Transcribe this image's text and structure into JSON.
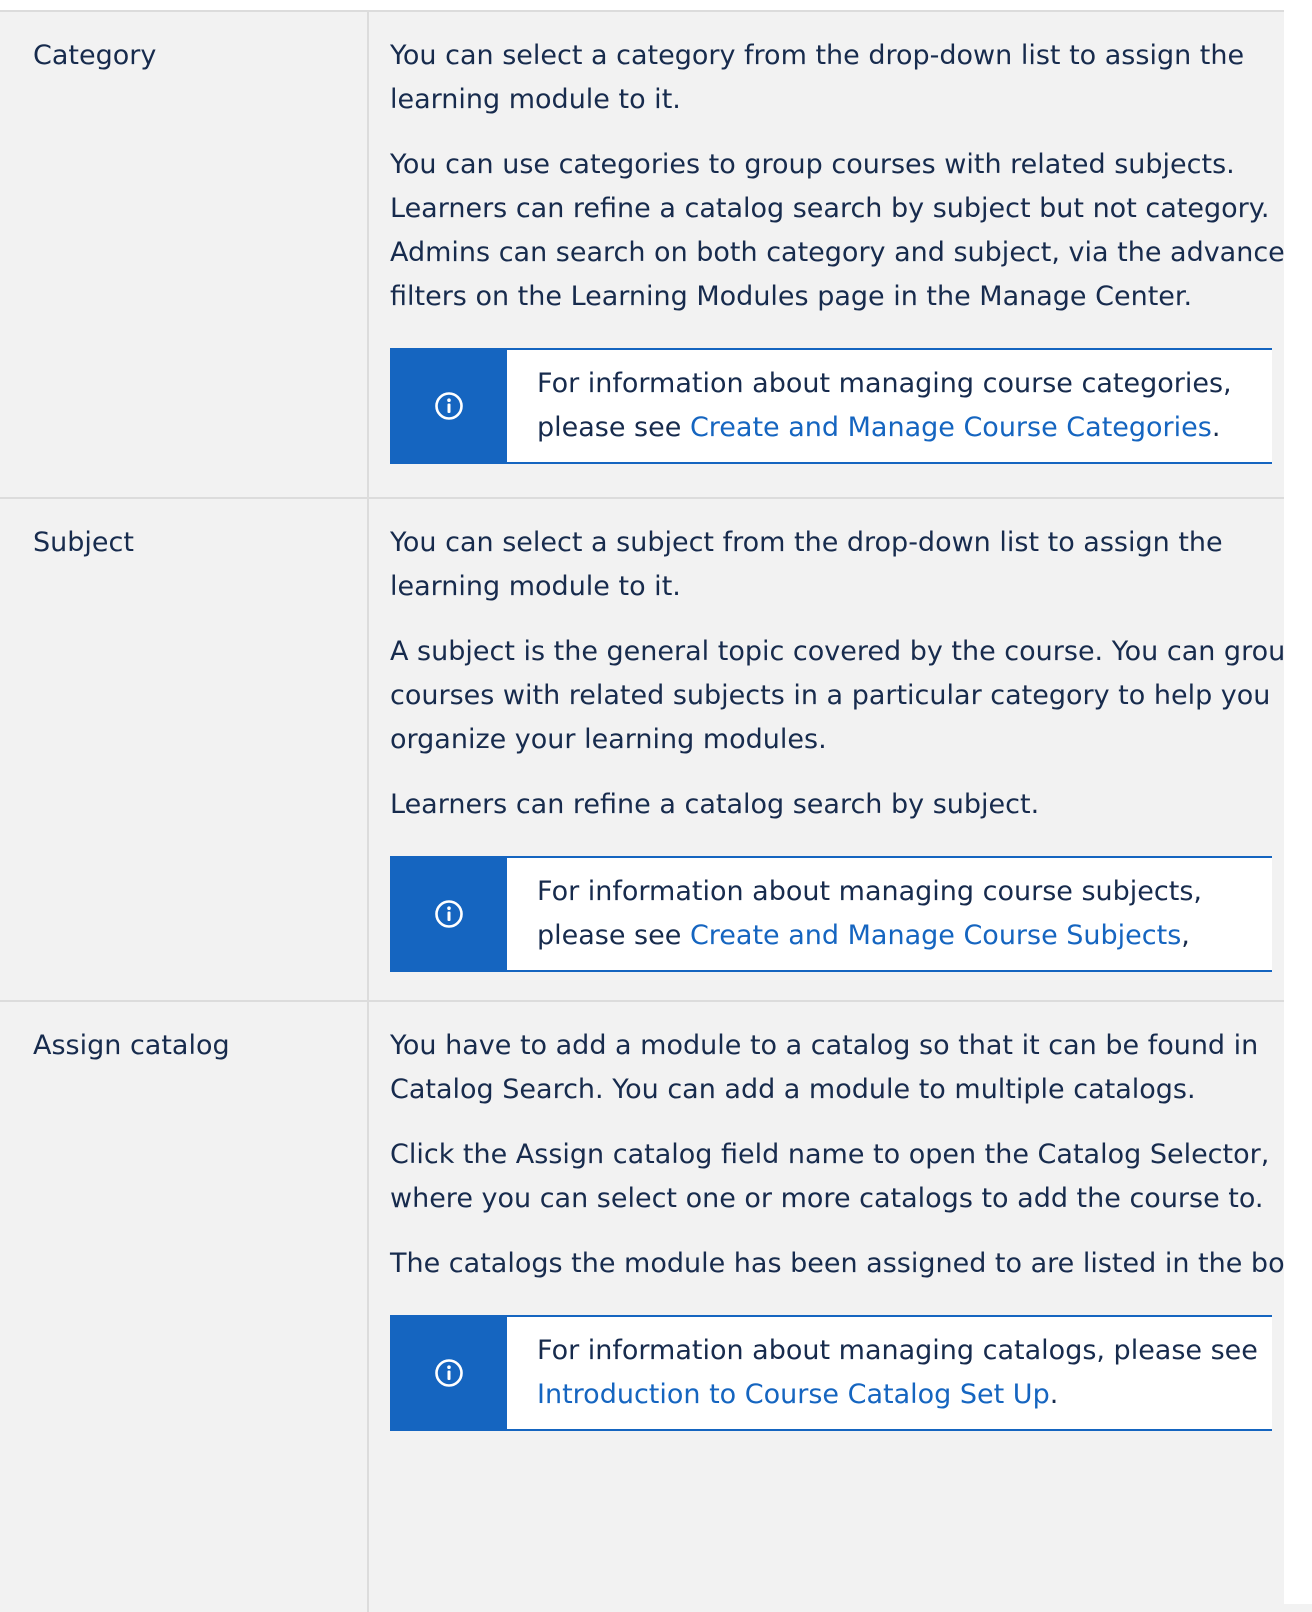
{
  "rows": [
    {
      "field": "Category",
      "paragraphs": [
        "You can select a category from the drop-down list to assign the learning module to it.",
        "You can use categories to group courses with related subjects. Learners can refine a catalog search by subject but not category. Admins can search on both category and subject, via the advanced filters on the Learning Modules page in the Manage Center."
      ],
      "note": {
        "icon": "info-icon",
        "before": "For information about managing course categories, please see ",
        "link": "Create and Manage Course Categories",
        "after": "."
      }
    },
    {
      "field": "Subject",
      "paragraphs": [
        "You can select a subject from the drop-down list to assign the learning module to it.",
        "A subject is the general topic covered by the course. You can group courses with related subjects in a particular category to help you organize your learning modules.",
        "Learners can refine a catalog search by subject."
      ],
      "note": {
        "icon": "info-icon",
        "before": "For information about managing course subjects, please see ",
        "link": "Create and Manage Course Subjects",
        "after": ","
      }
    },
    {
      "field": "Assign catalog",
      "paragraphs": [
        "You have to add a module to a catalog so that it can be found in Catalog Search. You can add a module to multiple catalogs.",
        "Click the Assign catalog field name to open the Catalog Selector, where you can select one or more catalogs to add the course to.",
        "The catalogs the module has been assigned to are listed in the box."
      ],
      "note": {
        "icon": "info-icon",
        "before": "For information about managing catalogs, please see ",
        "link": "Introduction to Course Catalog Set Up",
        "after": "."
      }
    }
  ],
  "colors": {
    "accent": "#1565c0",
    "row_background": "#f2f2f2",
    "border": "#dcdcdc",
    "text": "#172b4d"
  }
}
